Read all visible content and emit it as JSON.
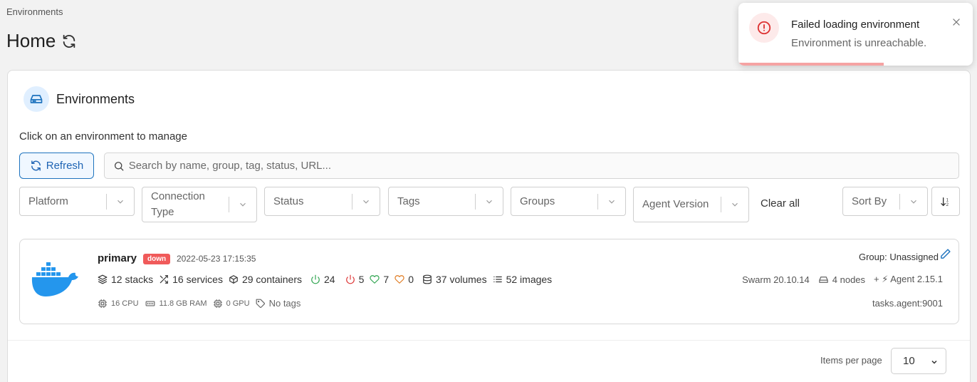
{
  "breadcrumb": "Environments",
  "page": {
    "title": "Home"
  },
  "widget": {
    "title": "Environments",
    "instruction": "Click on an environment to manage",
    "refresh_label": "Refresh",
    "search_placeholder": "Search by name, group, tag, status, URL..."
  },
  "filters": {
    "platform": "Platform",
    "connection_type": "Connection Type",
    "status": "Status",
    "tags": "Tags",
    "groups": "Groups",
    "agent_version": "Agent Version",
    "clear_all": "Clear all",
    "sort_by": "Sort By"
  },
  "environment": {
    "name": "primary",
    "status": "down",
    "date": "2022-05-23 17:15:35",
    "stacks": "12 stacks",
    "services": "16 services",
    "containers": "29 containers",
    "running": "24",
    "stopped": "5",
    "healthy": "7",
    "unhealthy": "0",
    "volumes": "37 volumes",
    "images": "52 images",
    "cpu": "16 CPU",
    "ram": "11.8 GB RAM",
    "gpu": "0 GPU",
    "tags": "No tags",
    "group": "Group: Unassigned",
    "version": "Swarm 20.10.14",
    "nodes": "4 nodes",
    "agent": "+ ⚡ Agent 2.15.1",
    "url": "tasks.agent:9001"
  },
  "pagination": {
    "items_per_page_label": "Items per page",
    "items_per_page_value": "10"
  },
  "toast": {
    "title": "Failed loading environment",
    "message": "Environment is unreachable.",
    "progress": 0.62
  },
  "colors": {
    "accent": "#1e73be",
    "danger": "#f05a5a",
    "docker_blue": "#2496ed",
    "running": "#2ea44f",
    "stopped": "#d33"
  }
}
